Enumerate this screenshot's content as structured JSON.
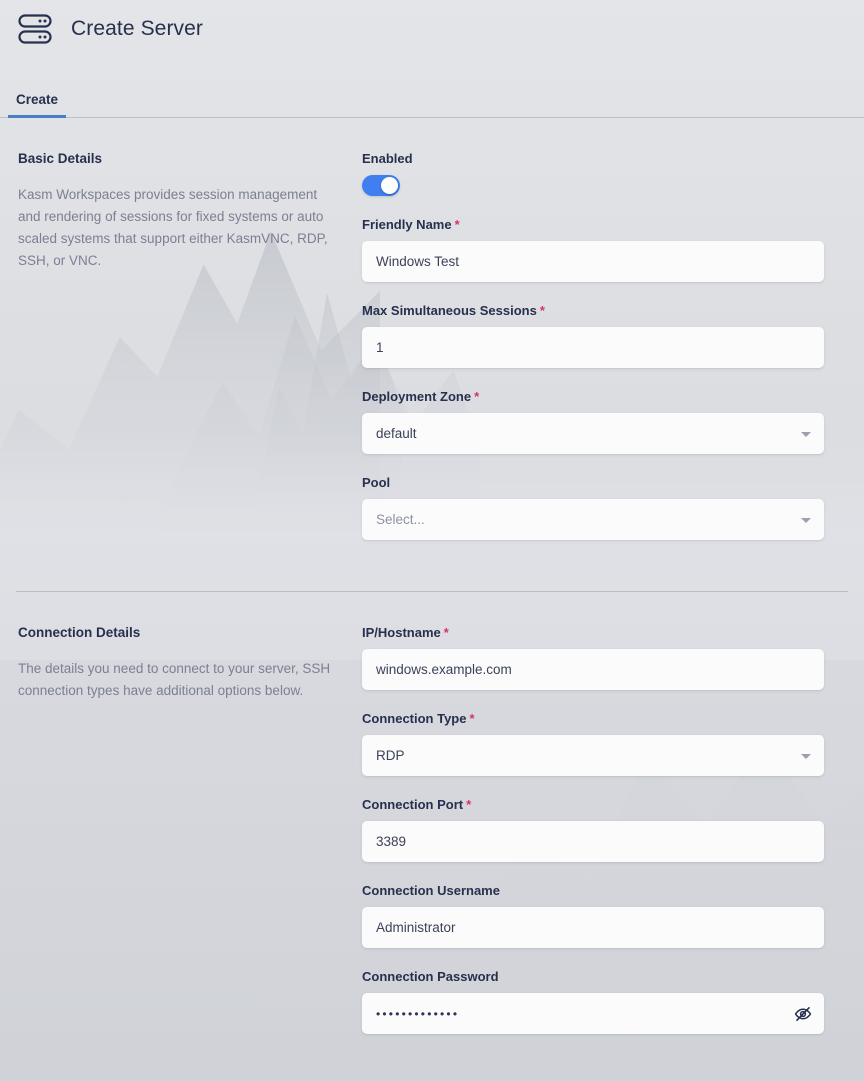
{
  "header": {
    "title": "Create Server",
    "icon": "server-icon"
  },
  "tabs": [
    {
      "label": "Create",
      "active": true
    }
  ],
  "sections": [
    {
      "id": "basic-details",
      "title": "Basic Details",
      "description": "Kasm Workspaces provides session management and rendering of sessions for fixed systems or auto scaled systems that support either KasmVNC, RDP, SSH, or VNC."
    },
    {
      "id": "connection-details",
      "title": "Connection Details",
      "description": "The details you need to connect to your server, SSH connection types have additional options below."
    }
  ],
  "fields": {
    "enabled": {
      "label": "Enabled",
      "required": false,
      "type": "toggle",
      "value": "on"
    },
    "friendly_name": {
      "label": "Friendly Name",
      "required": true,
      "required_marker": "*",
      "type": "text",
      "value": "Windows Test"
    },
    "max_sessions": {
      "label": "Max Simultaneous Sessions",
      "required": true,
      "required_marker": "*",
      "type": "text",
      "value": "1"
    },
    "deployment_zone": {
      "label": "Deployment Zone",
      "required": true,
      "required_marker": "*",
      "type": "select",
      "value": "default"
    },
    "pool": {
      "label": "Pool",
      "required": false,
      "type": "select",
      "value": "",
      "placeholder": "Select..."
    },
    "ip_hostname": {
      "label": "IP/Hostname",
      "required": true,
      "required_marker": "*",
      "type": "text",
      "value": "windows.example.com"
    },
    "connection_type": {
      "label": "Connection Type",
      "required": true,
      "required_marker": "*",
      "type": "select",
      "value": "RDP"
    },
    "connection_port": {
      "label": "Connection Port",
      "required": true,
      "required_marker": "*",
      "type": "text",
      "value": "3389"
    },
    "connection_username": {
      "label": "Connection Username",
      "required": false,
      "type": "text",
      "value": "Administrator"
    },
    "connection_password": {
      "label": "Connection Password",
      "required": false,
      "type": "password",
      "value": "•••••••••••••",
      "reveal_icon": "eye-slash-icon"
    }
  },
  "colors": {
    "accent_blue": "#3f7ff0",
    "tab_underline": "#4a7ec4",
    "required_red": "#d6336c",
    "text_dark": "#27304d",
    "text_muted": "#7b8093",
    "page_bg": "#dcdee2",
    "input_bg": "#fbfbfc"
  }
}
